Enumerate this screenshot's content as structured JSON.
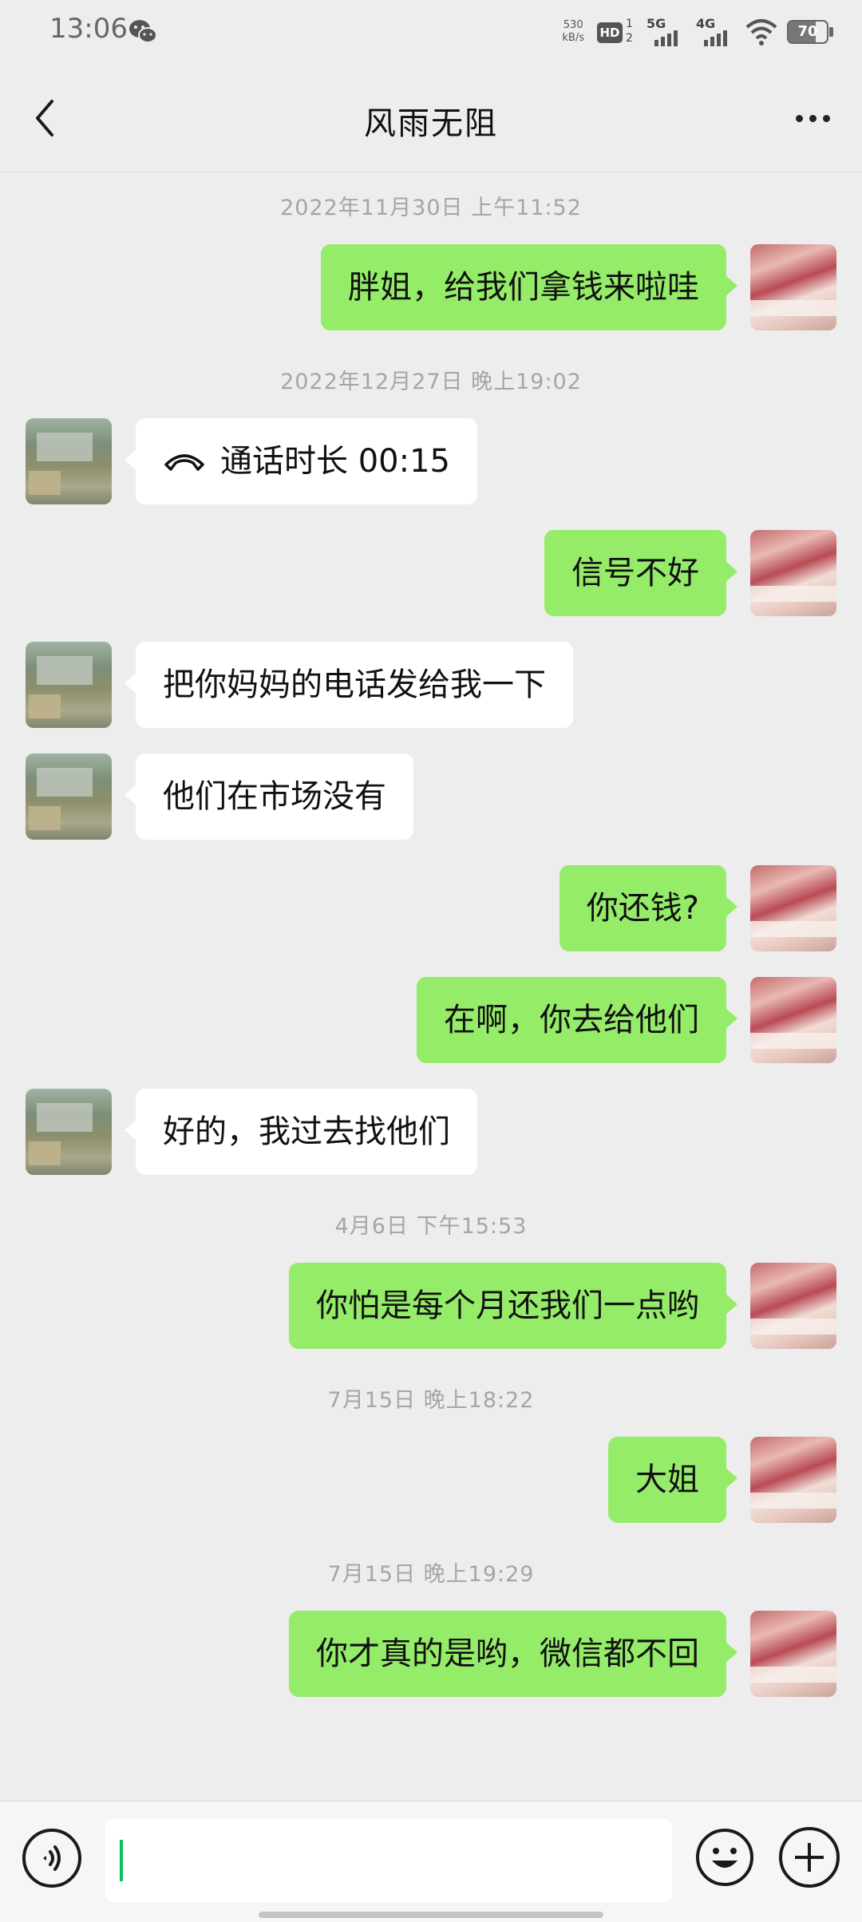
{
  "status_bar": {
    "time": "13:06",
    "net_speed_value": "530",
    "net_speed_unit": "kB/s",
    "hd_label": "HD",
    "hd_sim1": "1",
    "hd_sim2": "2",
    "net1": "5G",
    "net2": "4G",
    "battery_percent": "70",
    "battery_level": 0.7,
    "notification_icon": "wechat-icon"
  },
  "header": {
    "title": "风雨无阻",
    "back_icon": "chevron-left-icon",
    "more_icon": "more-icon"
  },
  "messages": [
    {
      "type": "timestamp",
      "text": "2022年11月30日 上午11:52"
    },
    {
      "type": "message",
      "sender": "me",
      "text": "胖姐，给我们拿钱来啦哇"
    },
    {
      "type": "timestamp",
      "text": "2022年12月27日 晚上19:02"
    },
    {
      "type": "call",
      "sender": "them",
      "text": "通话时长 00:15",
      "icon": "phone-hangup-icon"
    },
    {
      "type": "message",
      "sender": "me",
      "text": "信号不好"
    },
    {
      "type": "message",
      "sender": "them",
      "text": "把你妈妈的电话发给我一下"
    },
    {
      "type": "message",
      "sender": "them",
      "text": "他们在市场没有"
    },
    {
      "type": "message",
      "sender": "me",
      "text": "你还钱?"
    },
    {
      "type": "message",
      "sender": "me",
      "text": "在啊，你去给他们"
    },
    {
      "type": "message",
      "sender": "them",
      "text": "好的，我过去找他们"
    },
    {
      "type": "timestamp",
      "text": "4月6日 下午15:53"
    },
    {
      "type": "message",
      "sender": "me",
      "text": "你怕是每个月还我们一点哟"
    },
    {
      "type": "timestamp",
      "text": "7月15日 晚上18:22"
    },
    {
      "type": "message",
      "sender": "me",
      "text": "大姐"
    },
    {
      "type": "timestamp",
      "text": "7月15日 晚上19:29"
    },
    {
      "type": "message",
      "sender": "me",
      "text": "你才真的是哟，微信都不回"
    }
  ],
  "input_bar": {
    "voice_icon": "voice-input-icon",
    "emoji_icon": "emoji-icon",
    "plus_icon": "plus-icon",
    "input_value": ""
  },
  "colors": {
    "background": "#ededed",
    "my_bubble": "#95ec69",
    "their_bubble": "#ffffff",
    "timestamp": "#a5a5a5",
    "caret": "#07c160"
  }
}
